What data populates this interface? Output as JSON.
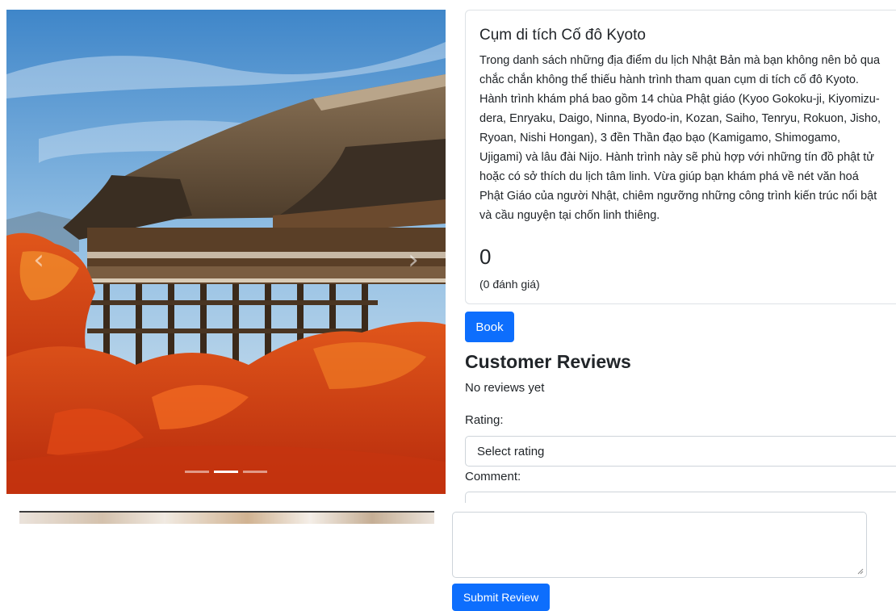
{
  "carousel": {
    "prev_label": "‹",
    "next_label": "›",
    "indicator_count": 3,
    "active_index": 1,
    "image_description_icon": "kiyomizu-dera-photo"
  },
  "attraction": {
    "title": "Cụm di tích Cố đô Kyoto",
    "description": "Trong danh sách những địa điểm du lịch Nhật Bản mà bạn không nên bỏ qua chắc chắn không thể thiếu hành trình tham quan cụm di tích cố đô Kyoto. Hành trình khám phá bao gồm 14 chùa Phật giáo (Kyoo Gokoku-ji, Kiyomizu-dera, Enryaku, Daigo, Ninna, Byodo-in, Kozan, Saiho, Tenryu, Rokuon, Jisho, Ryoan, Nishi Hongan), 3 đền Thần đạo bạo (Kamigamo, Shimogamo, Ujigami) và lâu đài Nijo. Hành trình này sẽ phù hợp với những tín đồ phật tử hoặc có sở thích du lịch tâm linh. Vừa giúp bạn khám phá về nét văn hoá Phật Giáo của người Nhật, chiêm ngưỡng những công trình kiến trúc nổi bật và cầu nguyện tại chốn linh thiêng.",
    "rating": "0",
    "rating_count": "(0 đánh giá)"
  },
  "actions": {
    "book_label": "Book",
    "submit_label": "Submit Review"
  },
  "reviews": {
    "heading": "Customer Reviews",
    "empty_text": "No reviews yet",
    "rating_label": "Rating:",
    "rating_placeholder": "Select rating",
    "comment_label": "Comment:"
  },
  "colors": {
    "primary": "#0d6efd",
    "border": "#dee2e6",
    "text": "#212529"
  }
}
